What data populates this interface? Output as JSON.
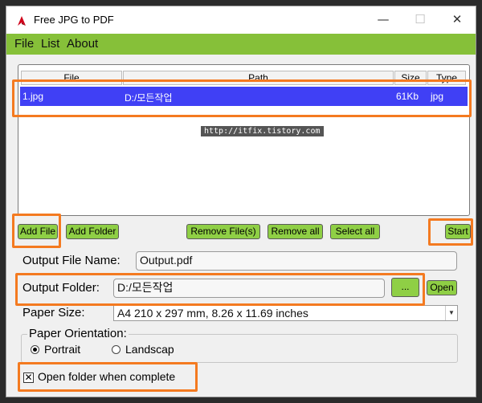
{
  "window": {
    "title": "Free JPG to PDF"
  },
  "titlebar": {
    "minimize": "—",
    "maximize": "☐",
    "close": "✕"
  },
  "menu": {
    "items": [
      "File",
      "List",
      "About"
    ]
  },
  "table": {
    "columns": [
      "File",
      "Path",
      "Size",
      "Type"
    ],
    "rows": [
      {
        "file": "1.jpg",
        "path": "D:/모든작업",
        "size": "61Kb",
        "type": "jpg"
      }
    ]
  },
  "watermark": "http://itfix.tistory.com",
  "buttons": {
    "add_file": "Add File",
    "add_folder": "Add Folder",
    "remove_files": "Remove File(s)",
    "remove_all": "Remove all",
    "select_all": "Select all",
    "start": "Start",
    "browse": "...",
    "open": "Open"
  },
  "output": {
    "file_name_label": "Output File Name:",
    "file_name_value": "Output.pdf",
    "folder_label": "Output Folder:",
    "folder_value": "D:/모든작업"
  },
  "paper": {
    "size_label": "Paper Size:",
    "size_value": "A4 210 x 297 mm, 8.26 x 11.69 inches",
    "orientation_label": "Paper Orientation:",
    "portrait": "Portrait",
    "landscape": "Landscap",
    "selected": "Portrait"
  },
  "open_folder": {
    "label": "Open folder when complete",
    "checked": true
  },
  "colors": {
    "menubar": "#86c039",
    "button": "#8fcf45",
    "selection": "#4040f5",
    "highlight": "#f47a20"
  }
}
